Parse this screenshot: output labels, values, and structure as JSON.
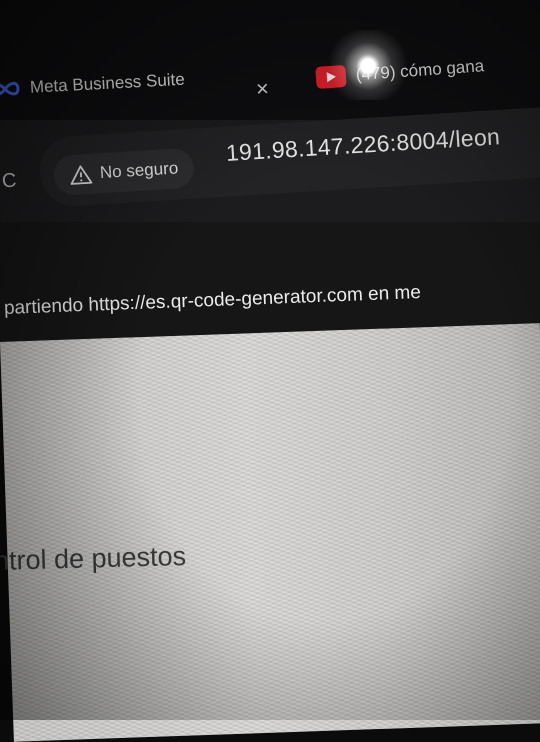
{
  "browser": {
    "tabs": [
      {
        "title": "Meta Business Suite",
        "icon": "meta-infinity-icon",
        "active": true
      },
      {
        "title": "(479) cómo gana",
        "icon": "youtube-icon",
        "active": false
      }
    ],
    "close_glyph": "×",
    "reload_glyph": "C",
    "security_label": "No seguro",
    "url": "191.98.147.226:8004/leon"
  },
  "share_bar": {
    "text": "partiendo https://es.qr-code-generator.com en me"
  },
  "page": {
    "title": "ntrol de puestos"
  },
  "colors": {
    "youtube_red": "#e8202a",
    "meta_blue": "#4a6cf7",
    "page_bg": "#d3d2d0"
  }
}
